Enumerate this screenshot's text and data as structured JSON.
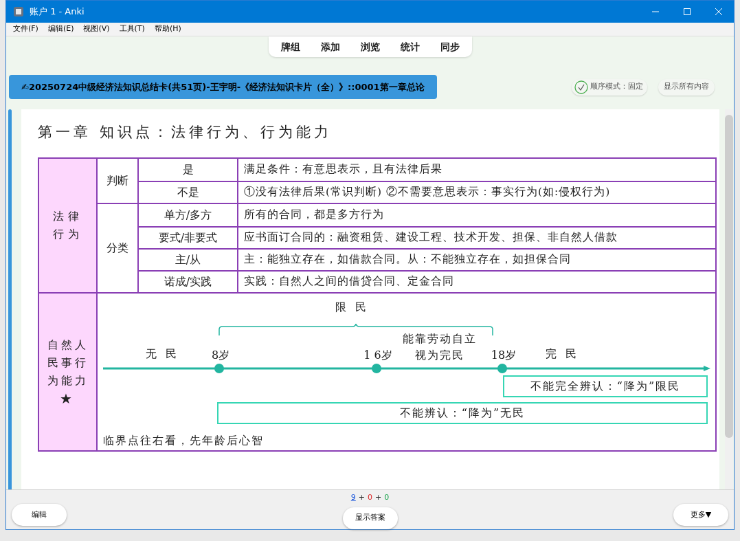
{
  "window": {
    "title": "账户 1 - Anki"
  },
  "menu": [
    "文件(F)",
    "编辑(E)",
    "视图(V)",
    "工具(T)",
    "帮助(H)"
  ],
  "toolbar": [
    "牌组",
    "添加",
    "浏览",
    "统计",
    "同步"
  ],
  "deck_title": "✍20250724中级经济法知识总结卡(共51页)-王宇明-《经济法知识卡片（全）》::0001第一章总论",
  "order_mode": {
    "label": "顺序模式：固定",
    "checked": true
  },
  "show_all_button": "显示所有内容",
  "card": {
    "heading": "第一章 知识点：法律行为、行为能力",
    "section_1": {
      "label": "法律行为",
      "groups": [
        {
          "label": "判断",
          "rows": [
            {
              "term": "是",
              "text": "满足条件：有意思表示，且有法律后果"
            },
            {
              "term": "不是",
              "text": "①没有法律后果(常识判断) ②不需要意思表示：事实行为(如:侵权行为)"
            }
          ]
        },
        {
          "label": "分类",
          "rows": [
            {
              "term": "单方/多方",
              "text": "所有的合同，都是多方行为"
            },
            {
              "term": "要式/非要式",
              "text": "应书面订合同的：融资租赁、建设工程、技术开发、担保、非自然人借款"
            },
            {
              "term": "主/从",
              "text": "主：能独立存在，如借款合同。从：不能独立存在，如担保合同"
            },
            {
              "term": "诺成/实践",
              "text": "实践：自然人之间的借贷合同、定金合同"
            }
          ]
        }
      ]
    },
    "section_2": {
      "label": "自然人民事行为能力",
      "mark": "★",
      "timeline": {
        "range_label": "限 民",
        "start_label": "无 民",
        "ages": [
          "8岁",
          "1 6岁",
          "18岁"
        ],
        "note_lines": [
          "能靠劳动自立",
          "视为完民"
        ],
        "end_label": "完 民",
        "boxes": [
          "不能完全辨认：“降为”限民",
          "不能辨认：“降为”无民"
        ]
      },
      "footnote": "临界点往右看，先年龄后心智"
    }
  },
  "counts": [
    {
      "value": "9",
      "color": "#1a56db"
    },
    {
      "value": "0",
      "color": "#dc2626"
    },
    {
      "value": "0",
      "color": "#16a34a"
    }
  ],
  "count_separator": "+",
  "buttons": {
    "edit": "编辑",
    "show_answer": "显示答案",
    "more": "更多▼"
  }
}
